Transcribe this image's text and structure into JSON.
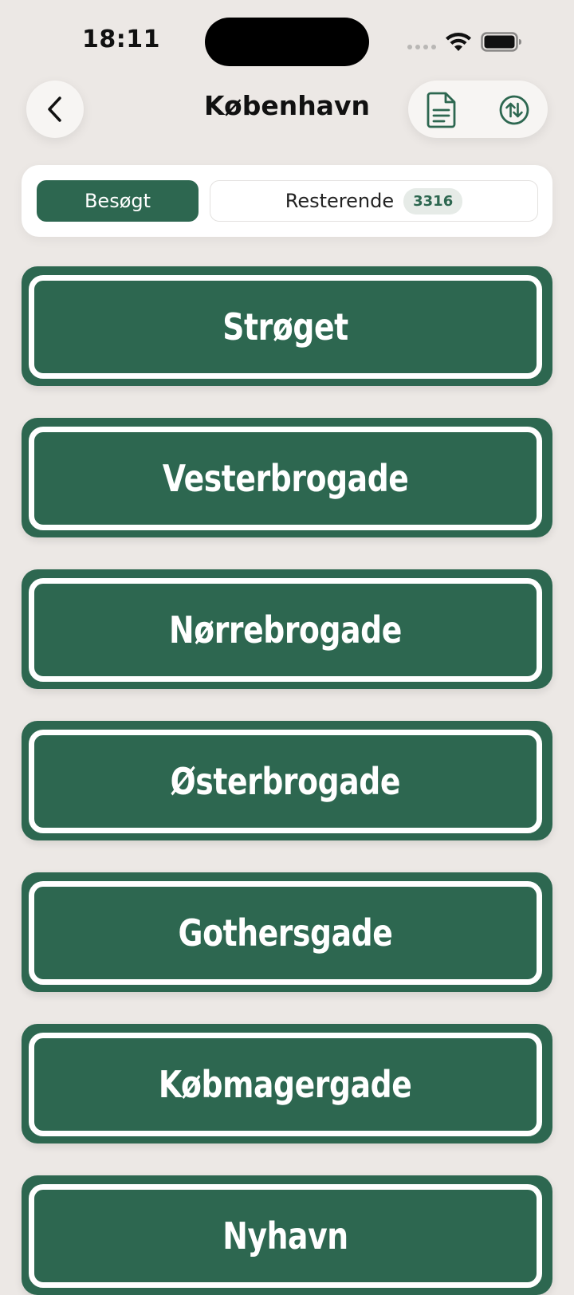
{
  "status_bar": {
    "time": "18:11",
    "icons": [
      "signal-dots",
      "wifi-icon",
      "battery-icon"
    ]
  },
  "nav": {
    "title": "København",
    "back_icon": "chevron-left-icon",
    "actions": [
      "document-icon",
      "sort-arrows-icon"
    ]
  },
  "segmented": {
    "visited_label": "Besøgt",
    "remaining_label": "Resterende",
    "remaining_count": "3316",
    "selected": "visited"
  },
  "streets": [
    {
      "name": "Strøget"
    },
    {
      "name": "Vesterbrogade"
    },
    {
      "name": "Nørrebrogade"
    },
    {
      "name": "Østerbrogade"
    },
    {
      "name": "Gothersgade"
    },
    {
      "name": "Købmagergade"
    },
    {
      "name": "Nyhavn"
    }
  ],
  "colors": {
    "background": "#ECE8E5",
    "accent_green": "#2D6750",
    "sign_border": "#FFFFFF"
  }
}
